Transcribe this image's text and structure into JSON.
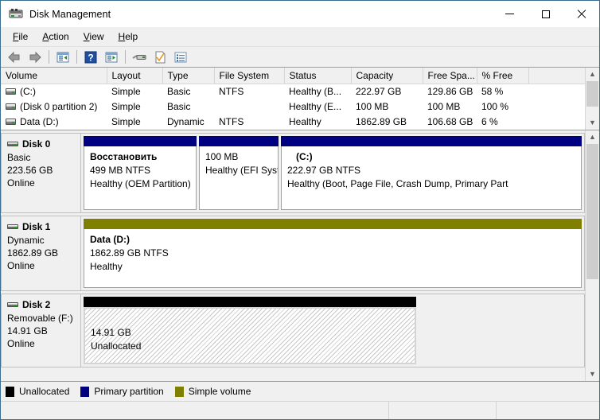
{
  "window": {
    "title": "Disk Management",
    "icon": "disk-management-icon",
    "controls": {
      "minimize": "Minimize",
      "maximize": "Maximize",
      "close": "Close"
    }
  },
  "menubar": {
    "items": [
      {
        "label": "File",
        "accel": "F"
      },
      {
        "label": "Action",
        "accel": "A"
      },
      {
        "label": "View",
        "accel": "V"
      },
      {
        "label": "Help",
        "accel": "H"
      }
    ]
  },
  "toolbar": {
    "buttons": [
      {
        "name": "back-icon",
        "tooltip": "Back"
      },
      {
        "name": "forward-icon",
        "tooltip": "Forward"
      },
      {
        "name": "up-one-level-icon",
        "tooltip": "Up One Level"
      },
      {
        "name": "help-icon",
        "tooltip": "Help"
      },
      {
        "name": "show-hide-console-tree-icon",
        "tooltip": "Show/Hide Console Tree"
      },
      {
        "name": "rescan-disks-icon",
        "tooltip": "Rescan Disks"
      },
      {
        "name": "properties-icon",
        "tooltip": "Properties"
      },
      {
        "name": "action-list-icon",
        "tooltip": "Show Action Pane"
      }
    ]
  },
  "volume_list": {
    "columns": [
      "Volume",
      "Layout",
      "Type",
      "File System",
      "Status",
      "Capacity",
      "Free Spa...",
      "% Free",
      ""
    ],
    "rows": [
      {
        "icon": "drive-icon",
        "volume": "(C:)",
        "layout": "Simple",
        "type": "Basic",
        "file_system": "NTFS",
        "status": "Healthy (B...",
        "capacity": "222.97 GB",
        "free_space": "129.86 GB",
        "percent_free": "58 %"
      },
      {
        "icon": "drive-icon",
        "volume": "(Disk 0 partition 2)",
        "layout": "Simple",
        "type": "Basic",
        "file_system": "",
        "status": "Healthy (E...",
        "capacity": "100 MB",
        "free_space": "100 MB",
        "percent_free": "100 %"
      },
      {
        "icon": "drive-icon",
        "volume": "Data (D:)",
        "layout": "Simple",
        "type": "Dynamic",
        "file_system": "NTFS",
        "status": "Healthy",
        "capacity": "1862.89 GB",
        "free_space": "106.68 GB",
        "percent_free": "6 %"
      }
    ]
  },
  "disks": [
    {
      "name": "Disk 0",
      "icon": "disk-icon",
      "type": "Basic",
      "size": "223.56 GB",
      "state": "Online",
      "partitions": [
        {
          "bar_color": "#000080",
          "kind": "primary",
          "label": "Восстановить",
          "size_fs": "499 MB NTFS",
          "health": "Healthy (OEM Partition)"
        },
        {
          "bar_color": "#000080",
          "kind": "primary",
          "label": "",
          "size_fs": "100 MB",
          "health": "Healthy (EFI Syste"
        },
        {
          "bar_color": "#000080",
          "kind": "primary",
          "label": "(C:)",
          "size_fs": "222.97 GB NTFS",
          "health": "Healthy (Boot, Page File, Crash Dump, Primary Part"
        }
      ]
    },
    {
      "name": "Disk 1",
      "icon": "disk-icon",
      "type": "Dynamic",
      "size": "1862.89 GB",
      "state": "Online",
      "partitions": [
        {
          "bar_color": "#808000",
          "kind": "simple",
          "label": "Data  (D:)",
          "size_fs": "1862.89 GB NTFS",
          "health": "Healthy"
        }
      ]
    },
    {
      "name": "Disk 2",
      "icon": "disk-icon",
      "type": "Removable (F:)",
      "size": "14.91 GB",
      "state": "Online",
      "partitions": [
        {
          "bar_color": "#000000",
          "kind": "unallocated",
          "label": "",
          "size_fs": "14.91 GB",
          "health": "Unallocated"
        }
      ]
    }
  ],
  "legend": {
    "items": [
      {
        "label": "Unallocated",
        "color": "#000000"
      },
      {
        "label": "Primary partition",
        "color": "#000080"
      },
      {
        "label": "Simple volume",
        "color": "#808000"
      }
    ]
  },
  "statusbar": {
    "left": "",
    "middle": "",
    "right": ""
  }
}
